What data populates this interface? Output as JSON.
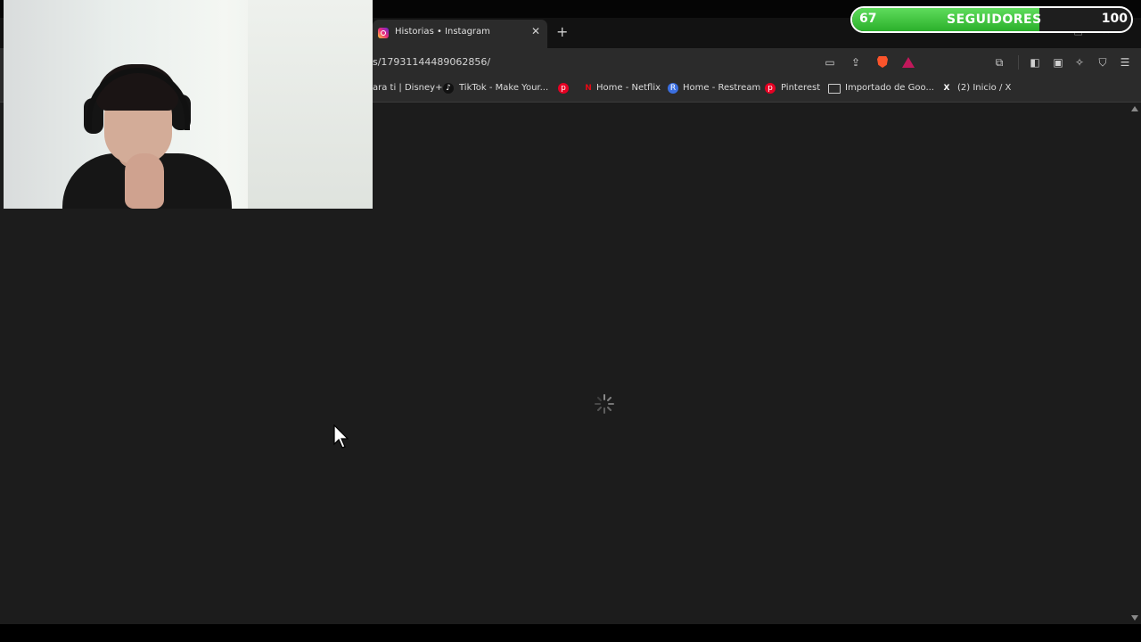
{
  "browser": {
    "tab": {
      "title": "Historias • Instagram",
      "close": "✕"
    },
    "new_tab": "+",
    "address_bar": {
      "url": "s/17931144489062856/"
    },
    "bookmarks": [
      {
        "label": "ara ti | Disney+"
      },
      {
        "label": "TikTok - Make Your..."
      },
      {
        "label": "Home - Netflix"
      },
      {
        "label": "Home - Restream"
      },
      {
        "label": "Pinterest"
      },
      {
        "label": "Importado de Goo..."
      },
      {
        "label": "(2) Inicio / X"
      }
    ]
  },
  "overlay": {
    "follower_goal": {
      "current": "67",
      "label": "SEGUIDORES",
      "goal": "100",
      "progress_fraction": 0.67,
      "fill_color": "#3cc43a"
    }
  },
  "page": {
    "state": "loading"
  }
}
